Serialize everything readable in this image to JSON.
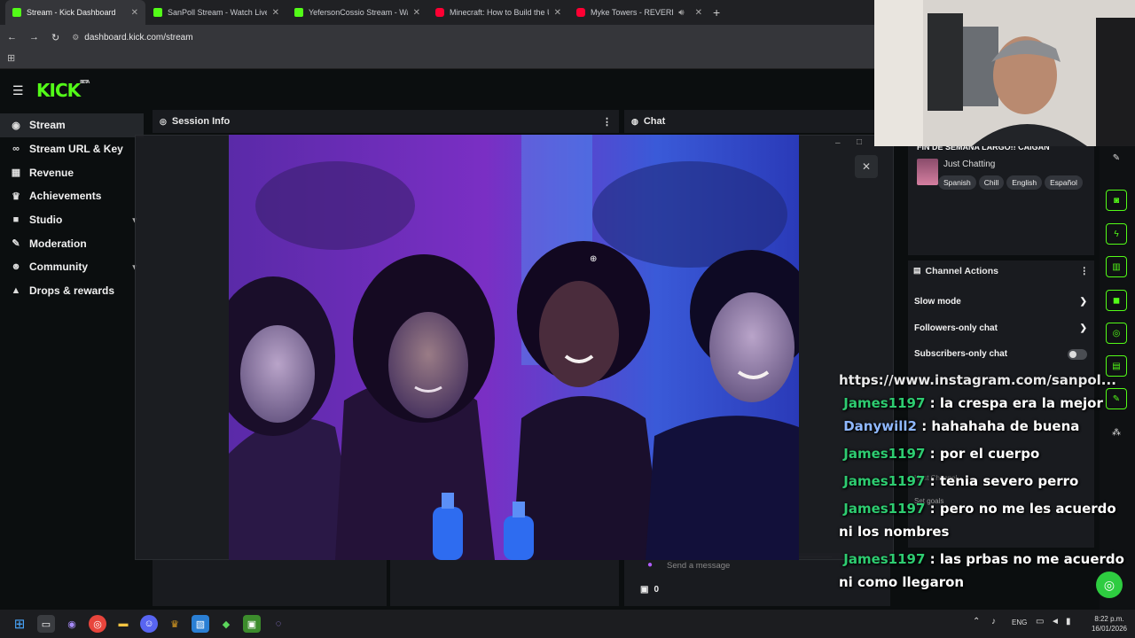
{
  "browser": {
    "tabs": [
      {
        "title": "Stream - Kick Dashboard",
        "favicon": "kick-icon",
        "active": true
      },
      {
        "title": "SanPoll Stream - Watch Live on",
        "favicon": "kick-icon",
        "active": false
      },
      {
        "title": "YefersonCossio Stream - Watch",
        "favicon": "kick-icon",
        "active": false
      },
      {
        "title": "Minecraft: How to Build the Ul",
        "favicon": "youtube-icon",
        "active": false
      },
      {
        "title": "Myke Towers - REVERENDO",
        "favicon": "youtube-icon",
        "active": false
      }
    ],
    "new_tab": "+",
    "url": "dashboard.kick.com/stream"
  },
  "app": {
    "logo": "KICK",
    "logo_badge": "BETA",
    "sidebar": [
      {
        "label": "Stream",
        "icon": "broadcast-icon",
        "active": true
      },
      {
        "label": "Stream URL & Key",
        "icon": "link-icon"
      },
      {
        "label": "Revenue",
        "icon": "bank-icon"
      },
      {
        "label": "Achievements",
        "icon": "trophy-icon"
      },
      {
        "label": "Studio",
        "icon": "video-icon",
        "chevron": true
      },
      {
        "label": "Moderation",
        "icon": "wrench-icon"
      },
      {
        "label": "Community",
        "icon": "users-icon",
        "chevron": true
      },
      {
        "label": "Drops & rewards",
        "icon": "gift-icon"
      }
    ],
    "panels": {
      "session_info": "Session Info",
      "chat": "Chat",
      "send_placeholder": "Send a message",
      "viewer_count": "0"
    },
    "stream_info": {
      "title": "FIN DE SEMANA LARGO!! CAIGAN",
      "category": "Just Chatting",
      "tags": [
        "Spanish",
        "Chill",
        "English",
        "Español"
      ]
    },
    "channel_actions": {
      "header": "Channel Actions",
      "items": [
        {
          "label": "Slow mode",
          "kind": "arrow"
        },
        {
          "label": "Followers-only chat",
          "kind": "arrow"
        },
        {
          "label": "Subscribers-only chat",
          "kind": "toggle"
        }
      ],
      "faded_items": [
        "Host Channel",
        "Set goals"
      ]
    }
  },
  "overlay_chat": {
    "partial_link": "https://www.instagram.com/sanpol...",
    "messages": [
      {
        "user": "James1197",
        "text": " : la crespa era la mejor"
      },
      {
        "user": "Danywill2",
        "text": " : hahahaha de buena"
      },
      {
        "user": "James1197",
        "text": " : por el cuerpo"
      },
      {
        "user": "James1197",
        "text": " : tenia severo perro"
      },
      {
        "user": "James1197",
        "text": " : pero no me les acuerdo ni los nombres"
      },
      {
        "user": "James1197",
        "text": " : las prbas no me acuerdo ni como llegaron"
      }
    ]
  },
  "taskbar": {
    "language": "ENG",
    "time": "8:22 p.m.",
    "date": "16/01/2026"
  },
  "colors": {
    "kick_green": "#53fc18",
    "chat_user": "#2ecc71",
    "chat_user_alt": "#8fb8ff"
  }
}
